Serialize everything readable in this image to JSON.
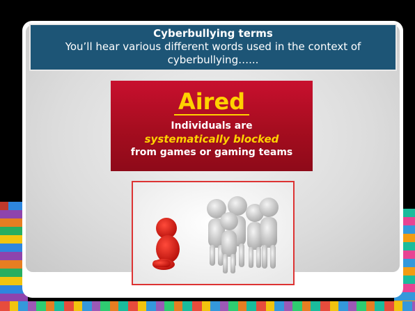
{
  "header": {
    "title": "Cyberbullying terms",
    "subtitle": "You’ll hear various different words used in the context of cyberbullying…..."
  },
  "term": {
    "word": "Aired",
    "line1": "Individuals are",
    "emphasis": "systematically blocked",
    "line3": "from games or gaming teams"
  },
  "image": {
    "icon": "isolated-figure-illustration"
  },
  "colors": {
    "title_bg": "#1d5576",
    "term_bg": "#c8102e",
    "accent": "#ffd200"
  }
}
